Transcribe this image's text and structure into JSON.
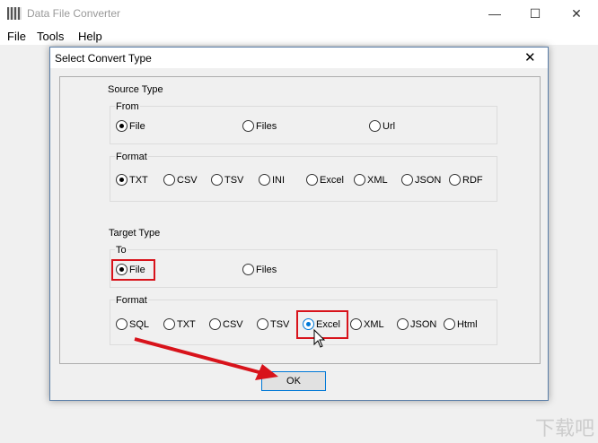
{
  "app": {
    "title": "Data File Converter",
    "menu": [
      "File",
      "Tools",
      "Help"
    ]
  },
  "dialog": {
    "title": "Select Convert Type",
    "source": {
      "label": "Source Type",
      "from_label": "From",
      "from": [
        "File",
        "Files",
        "Url"
      ],
      "from_selected": "File",
      "format_label": "Format",
      "formats": [
        "TXT",
        "CSV",
        "TSV",
        "INI",
        "Excel",
        "XML",
        "JSON",
        "RDF"
      ],
      "format_selected": "TXT"
    },
    "target": {
      "label": "Target Type",
      "to_label": "To",
      "to": [
        "File",
        "Files"
      ],
      "to_selected": "File",
      "format_label": "Format",
      "formats": [
        "SQL",
        "TXT",
        "CSV",
        "TSV",
        "Excel",
        "XML",
        "JSON",
        "Html"
      ],
      "format_selected": "Excel"
    },
    "ok_label": "OK"
  },
  "colors": {
    "highlight": "#d8131b",
    "accent": "#0078d7"
  },
  "watermark": "下载吧"
}
